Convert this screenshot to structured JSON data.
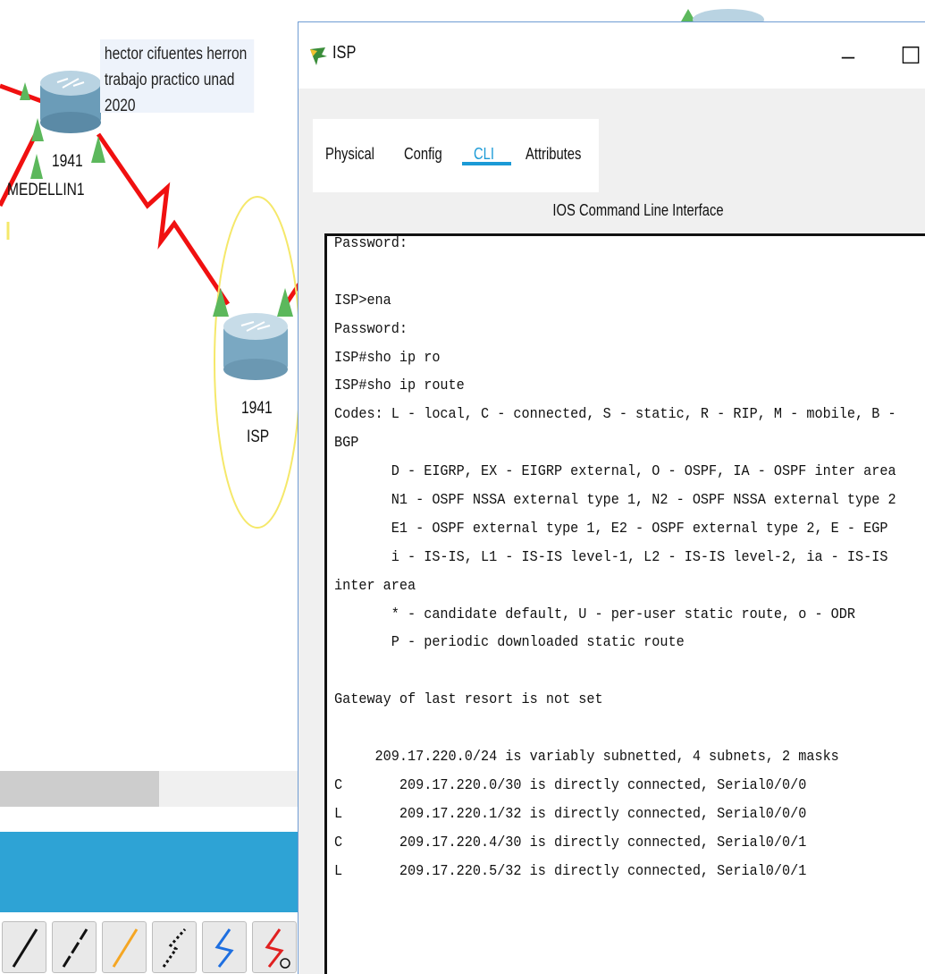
{
  "topology": {
    "note_lines": [
      "hector cifuentes herron",
      "trabajo practico unad 2020"
    ],
    "devices": [
      {
        "model": "1941",
        "name": "MEDELLIN1"
      },
      {
        "model": "1941",
        "name": "ISP"
      }
    ],
    "colors": {
      "link": "#f01010",
      "port_up": "#5cb85c",
      "selection": "#f5e86a",
      "palette_bar": "#2ea3d5"
    },
    "connection_tools": [
      "console-cable-icon",
      "straight-through-cable-icon",
      "crossover-cable-icon",
      "serial-dte-icon",
      "serial-dce-icon",
      "serial-dce-clock-icon"
    ]
  },
  "window": {
    "title": "ISP",
    "minimize": "–",
    "maximize": "☐",
    "tabs": [
      {
        "label": "Physical",
        "active": false
      },
      {
        "label": "Config",
        "active": false
      },
      {
        "label": "CLI",
        "active": true
      },
      {
        "label": "Attributes",
        "active": false
      }
    ],
    "cli_heading": "IOS Command Line Interface"
  },
  "terminal": {
    "lines": [
      "Password:",
      "",
      "ISP>ena",
      "Password:",
      "ISP#sho ip ro",
      "ISP#sho ip route",
      "Codes: L - local, C - connected, S - static, R - RIP, M - mobile, B -",
      "BGP",
      "       D - EIGRP, EX - EIGRP external, O - OSPF, IA - OSPF inter area",
      "       N1 - OSPF NSSA external type 1, N2 - OSPF NSSA external type 2",
      "       E1 - OSPF external type 1, E2 - OSPF external type 2, E - EGP",
      "       i - IS-IS, L1 - IS-IS level-1, L2 - IS-IS level-2, ia - IS-IS",
      "inter area",
      "       * - candidate default, U - per-user static route, o - ODR",
      "       P - periodic downloaded static route",
      "",
      "Gateway of last resort is not set",
      "",
      "     209.17.220.0/24 is variably subnetted, 4 subnets, 2 masks",
      "C       209.17.220.0/30 is directly connected, Serial0/0/0",
      "L       209.17.220.1/32 is directly connected, Serial0/0/0",
      "C       209.17.220.4/30 is directly connected, Serial0/0/1",
      "L       209.17.220.5/32 is directly connected, Serial0/0/1"
    ]
  }
}
